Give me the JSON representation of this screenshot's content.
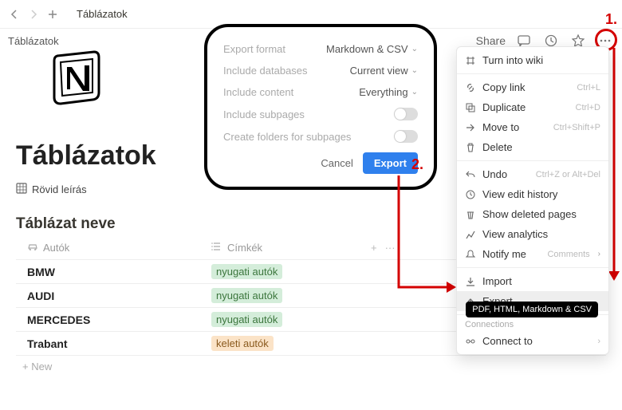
{
  "topbar": {
    "tab": "Táblázatok"
  },
  "breadcrumb": "Táblázatok",
  "header": {
    "share": "Share",
    "page_title": "Táblázatok",
    "desc": "Rövid leírás"
  },
  "db": {
    "title": "Táblázat neve",
    "col_name": "Autók",
    "col_tags": "Címkék",
    "rows": [
      {
        "name": "BMW",
        "tag": "nyugati autók",
        "tag_class": "green"
      },
      {
        "name": "AUDI",
        "tag": "nyugati autók",
        "tag_class": "green"
      },
      {
        "name": "MERCEDES",
        "tag": "nyugati autók",
        "tag_class": "green"
      },
      {
        "name": "Trabant",
        "tag": "keleti autók",
        "tag_class": "orange"
      }
    ],
    "new_label": "+  New"
  },
  "export": {
    "format_label": "Export format",
    "format_value": "Markdown & CSV",
    "databases_label": "Include databases",
    "databases_value": "Current view",
    "content_label": "Include content",
    "content_value": "Everything",
    "subpages_label": "Include subpages",
    "folders_label": "Create folders for subpages",
    "cancel": "Cancel",
    "export_btn": "Export"
  },
  "menu": {
    "turn_into_wiki": "Turn into wiki",
    "copy_link": "Copy link",
    "copy_link_sc": "Ctrl+L",
    "duplicate": "Duplicate",
    "duplicate_sc": "Ctrl+D",
    "move_to": "Move to",
    "move_to_sc": "Ctrl+Shift+P",
    "delete": "Delete",
    "undo": "Undo",
    "undo_sc": "Ctrl+Z or Alt+Del",
    "view_history": "View edit history",
    "show_deleted": "Show deleted pages",
    "view_analytics": "View analytics",
    "notify_me": "Notify me",
    "notify_me_sc": "Comments",
    "import": "Import",
    "export": "Export",
    "connections": "Connections",
    "connect_to": "Connect to"
  },
  "tooltip": "PDF, HTML, Markdown & CSV",
  "annotations": {
    "step1": "1.",
    "step2": "2."
  }
}
